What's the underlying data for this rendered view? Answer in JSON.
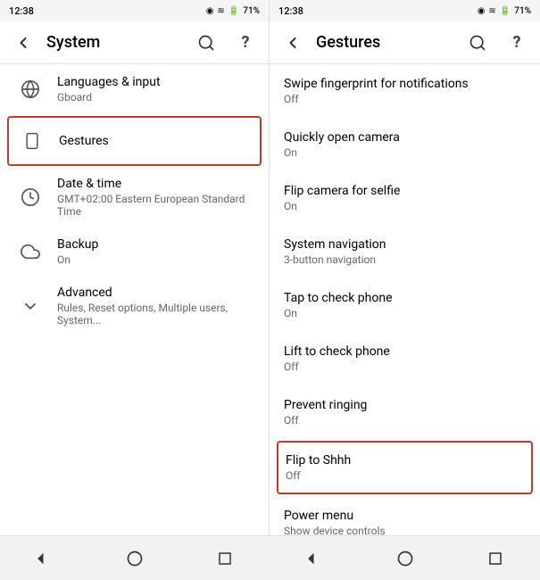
{
  "left": {
    "statusBar": {
      "time": "12:38",
      "icons": "◉ ≋ 🔋71%"
    },
    "topBar": {
      "title": "System",
      "backIcon": "←",
      "searchIcon": "⌕",
      "helpIcon": "?"
    },
    "menuItems": [
      {
        "id": "languages",
        "icon": "globe",
        "title": "Languages & input",
        "subtitle": "Gboard"
      },
      {
        "id": "gestures",
        "icon": "phone",
        "title": "Gestures",
        "subtitle": "",
        "active": true
      },
      {
        "id": "datetime",
        "icon": "clock",
        "title": "Date & time",
        "subtitle": "GMT+02:00 Eastern European Standard Time"
      },
      {
        "id": "backup",
        "icon": "cloud",
        "title": "Backup",
        "subtitle": "On"
      },
      {
        "id": "advanced",
        "icon": "chevron",
        "title": "Advanced",
        "subtitle": "Rules, Reset options, Multiple users, System..."
      }
    ]
  },
  "right": {
    "statusBar": {
      "time": "12:38",
      "icons": "◉ ≋ 🔋71%"
    },
    "topBar": {
      "title": "Gestures",
      "backIcon": "←",
      "searchIcon": "⌕",
      "helpIcon": "?"
    },
    "gestureItems": [
      {
        "id": "swipe-fingerprint",
        "title": "Swipe fingerprint for notifications",
        "subtitle": "Off",
        "highlighted": false
      },
      {
        "id": "open-camera",
        "title": "Quickly open camera",
        "subtitle": "On",
        "highlighted": false
      },
      {
        "id": "flip-camera",
        "title": "Flip camera for selfie",
        "subtitle": "On",
        "highlighted": false
      },
      {
        "id": "system-nav",
        "title": "System navigation",
        "subtitle": "3-button navigation",
        "highlighted": false
      },
      {
        "id": "tap-check-phone",
        "title": "Tap to check phone",
        "subtitle": "On",
        "highlighted": false
      },
      {
        "id": "lift-check-phone",
        "title": "Lift to check phone",
        "subtitle": "Off",
        "highlighted": false
      },
      {
        "id": "prevent-ringing",
        "title": "Prevent ringing",
        "subtitle": "Off",
        "highlighted": false
      },
      {
        "id": "flip-shhh",
        "title": "Flip to Shhh",
        "subtitle": "Off",
        "highlighted": true
      },
      {
        "id": "power-menu",
        "title": "Power menu",
        "subtitle": "Show device controls",
        "highlighted": false
      }
    ]
  },
  "bottomNav": {
    "backIcon": "◁",
    "homeIcon": "○",
    "recentsIcon": "□"
  }
}
